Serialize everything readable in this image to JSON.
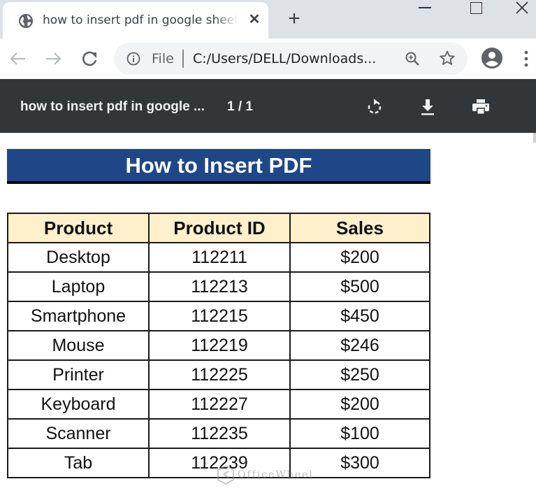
{
  "browser": {
    "tab": {
      "title": "how to insert pdf in google sheets",
      "favicon": "globe-icon",
      "close_glyph": "✕"
    },
    "new_tab_glyph": "+",
    "window_controls": [
      "minimize",
      "maximize",
      "close"
    ],
    "omnibox": {
      "scheme_label": "File",
      "url": "C:/Users/DELL/Downloads...",
      "icons": [
        "info-icon",
        "zoom-icon",
        "star-icon"
      ]
    },
    "nav_icons": [
      "back-arrow-icon",
      "forward-arrow-icon",
      "reload-icon"
    ],
    "right_icons": [
      "profile-icon",
      "menu-icon"
    ]
  },
  "pdf_viewer": {
    "title": "how to insert pdf in google ...",
    "page_indicator": "1 / 1",
    "actions": [
      "rotate-icon",
      "download-icon",
      "print-icon"
    ]
  },
  "document": {
    "heading": "How to Insert PDF",
    "heading_color": "#1f4788",
    "header_fill": "#fff0cc",
    "table": {
      "columns": [
        "Product",
        "Product ID",
        "Sales"
      ],
      "rows": [
        [
          "Desktop",
          "112211",
          "$200"
        ],
        [
          "Laptop",
          "112213",
          "$500"
        ],
        [
          "Smartphone",
          "112215",
          "$450"
        ],
        [
          "Mouse",
          "112219",
          "$246"
        ],
        [
          "Printer",
          "112225",
          "$250"
        ],
        [
          "Keyboard",
          "112227",
          "$200"
        ],
        [
          "Scanner",
          "112235",
          "$100"
        ],
        [
          "Tab",
          "112239",
          "$300"
        ]
      ]
    },
    "watermark": "OfficeWheel"
  }
}
